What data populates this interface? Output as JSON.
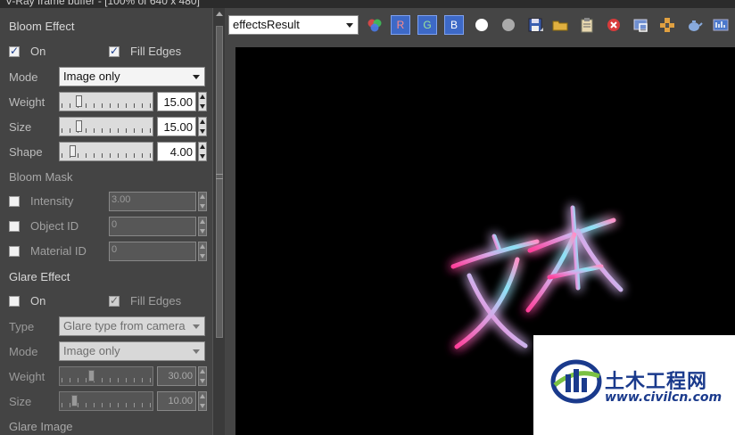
{
  "window": {
    "title": "V-Ray frame buffer - [100% of 640 x 480]"
  },
  "bloom": {
    "header": "Bloom Effect",
    "on_label": "On",
    "on_checked": true,
    "fill_edges_label": "Fill Edges",
    "fill_edges_checked": true,
    "mode_label": "Mode",
    "mode_value": "Image only",
    "weight_label": "Weight",
    "weight_value": "15.00",
    "weight_fraction": 0.15,
    "size_label": "Size",
    "size_value": "15.00",
    "size_fraction": 0.15,
    "shape_label": "Shape",
    "shape_value": "4.00",
    "shape_fraction": 0.08
  },
  "bloom_mask": {
    "header": "Bloom Mask",
    "intensity_label": "Intensity",
    "intensity_value": "3.00",
    "object_id_label": "Object ID",
    "object_id_value": "0",
    "material_id_label": "Material ID",
    "material_id_value": "0"
  },
  "glare": {
    "header": "Glare Effect",
    "on_label": "On",
    "on_checked": false,
    "fill_edges_label": "Fill Edges",
    "fill_edges_checked": true,
    "type_label": "Type",
    "type_value": "Glare type from camera",
    "mode_label": "Mode",
    "mode_value": "Image only",
    "weight_label": "Weight",
    "weight_value": "30.00",
    "weight_fraction": 0.3,
    "size_label": "Size",
    "size_value": "10.00",
    "size_fraction": 0.1
  },
  "glare_image": {
    "header": "Glare Image"
  },
  "toolbar": {
    "channel_value": "effectsResult",
    "r_label": "R",
    "g_label": "G",
    "b_label": "B"
  },
  "render": {
    "text": "文本"
  },
  "watermark": {
    "name": "土木工程网",
    "url": "www.civilcn.com"
  },
  "colors": {
    "glow_pink": "#ff4fa3",
    "glow_cyan": "#7fe7ff",
    "panel_bg": "#444444",
    "toolbar_blue": "#3d69c7"
  }
}
